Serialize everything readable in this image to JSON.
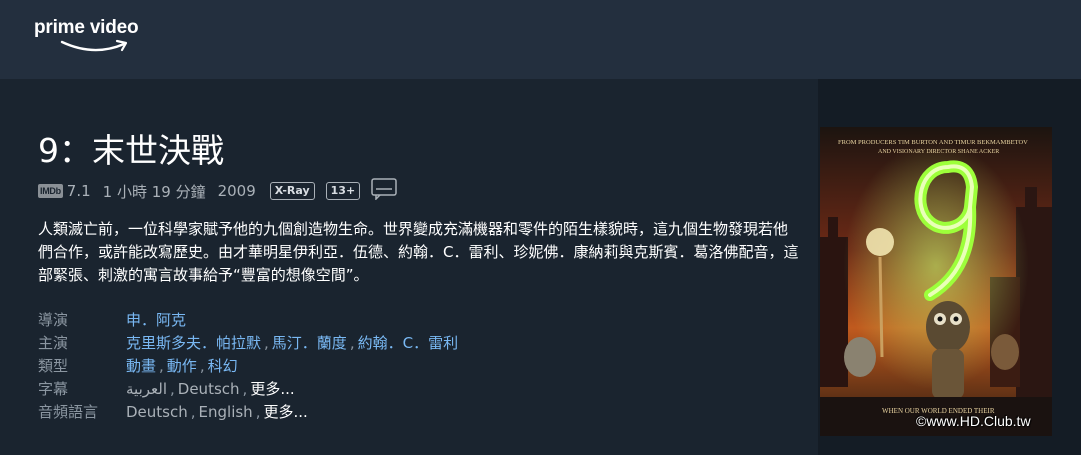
{
  "header": {
    "brand": "prime video"
  },
  "title": "9：末世決戰",
  "meta": {
    "imdb_label": "IMDb",
    "rating": "7.1",
    "runtime": "1 小時 19 分鐘",
    "year": "2009",
    "xray": "X-Ray",
    "age": "13+",
    "subtitles_icon": "subtitles-icon"
  },
  "synopsis": "人類滅亡前，一位科學家賦予他的九個創造物生命。世界變成充滿機器和零件的陌生樣貌時，這九個生物發現若他們合作，或許能改寫歷史。由才華明星伊利亞．伍德、約翰．C．雷利、珍妮佛．康納莉與克斯賓．葛洛佛配音，這部緊張、刺激的寓言故事給予“豐富的想像空間”。",
  "details": {
    "director": {
      "label": "導演",
      "values": [
        "申．阿克"
      ]
    },
    "cast": {
      "label": "主演",
      "values": [
        "克里斯多夫．帕拉默",
        "馬汀．蘭度",
        "約翰．C．雷利"
      ]
    },
    "genre": {
      "label": "類型",
      "values": [
        "動畫",
        "動作",
        "科幻"
      ]
    },
    "subtitles": {
      "label": "字幕",
      "values": [
        "العربية",
        "Deutsch",
        "更多..."
      ]
    },
    "audio": {
      "label": "音頻語言",
      "values": [
        "Deutsch",
        "English",
        "更多..."
      ]
    }
  },
  "poster": {
    "credits_line1": "FROM PRODUCERS TIM BURTON AND TIMUR BEKMAMBETOV",
    "credits_line2": "AND VISIONARY DIRECTOR SHANE ACKER",
    "big_title": "9",
    "tagline": "WHEN OUR WORLD ENDED THEIR",
    "watermark": "©www.HD.Club.tw"
  },
  "colors": {
    "topbar": "#232f3e",
    "background": "#1a242f",
    "link": "#79b8f3",
    "label": "#8b96a1"
  }
}
